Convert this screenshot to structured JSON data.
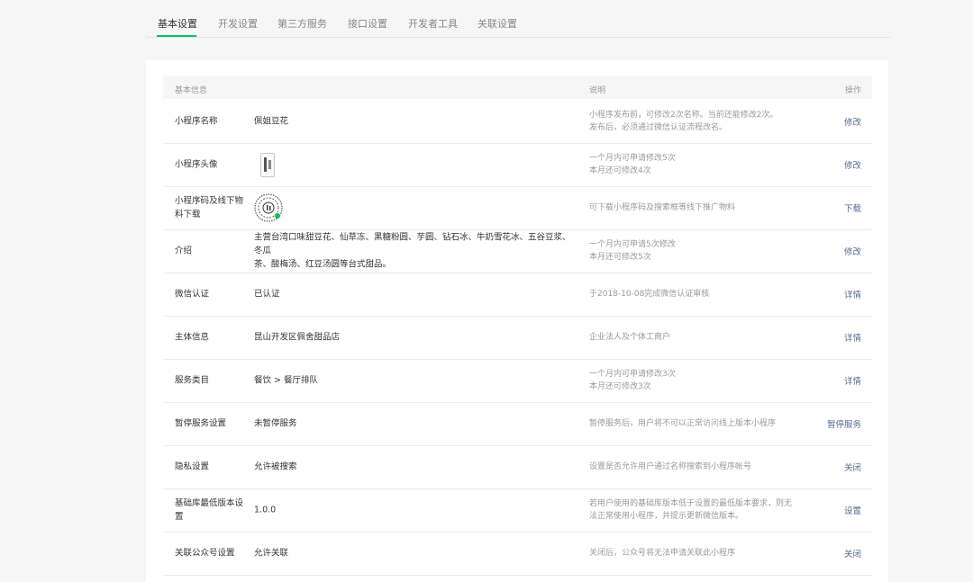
{
  "tabs": [
    "基本设置",
    "开发设置",
    "第三方服务",
    "接口设置",
    "开发者工具",
    "关联设置"
  ],
  "table": {
    "headers": {
      "col1": "基本信息",
      "col3": "说明",
      "col4": "操作"
    },
    "rows": [
      {
        "label": "小程序名称",
        "value": "佩姐豆花",
        "desc1": "小程序发布前，可修改2次名称。当前还能修改2次。",
        "desc2": "发布后，必须通过微信认证流程改名。",
        "action": "修改"
      },
      {
        "label": "小程序头像",
        "value": "",
        "desc1": "一个月内可申请修改5次",
        "desc2": "本月还可修改4次",
        "action": "修改"
      },
      {
        "label1": "小程序码及线下物",
        "label2": "料下载",
        "value": "",
        "desc1": "可下载小程序码及搜索框等线下推广物料",
        "desc2": "",
        "action": "下载"
      },
      {
        "label": "介绍",
        "value1": "主营台湾口味甜豆花、仙草冻、黑糖粉圆、芋圆、钻石冰、牛奶雪花冰、五谷豆浆、冬瓜",
        "value2": "茶、酸梅汤、红豆汤圆等台式甜品。",
        "desc1": "一个月内可申请5次修改",
        "desc2": "本月还可修改5次",
        "action": "修改"
      },
      {
        "label": "微信认证",
        "value": "已认证",
        "desc1": "于2018-10-08完成微信认证审核",
        "desc2": "",
        "action": "详情"
      },
      {
        "label": "主体信息",
        "value": "昆山开发区佩舍甜品店",
        "desc1": "企业法人及个体工商户",
        "desc2": "",
        "action": "详情"
      },
      {
        "label": "服务类目",
        "value": "餐饮 > 餐厅排队",
        "desc1": "一个月内可申请修改3次",
        "desc2": "本月还可修改3次",
        "action": "详情"
      },
      {
        "label": "暂停服务设置",
        "value": "未暂停服务",
        "desc1": "暂停服务后，用户将不可以正常访问线上版本小程序",
        "desc2": "",
        "action": "暂停服务"
      },
      {
        "label": "隐私设置",
        "value": "允许被搜索",
        "desc1": "设置是否允许用户通过名称搜索到小程序帐号",
        "desc2": "",
        "action": "关闭"
      },
      {
        "label1": "基础库最低版本设",
        "label2": "置",
        "value": "1.0.0",
        "desc1": "若用户使用的基础库版本低于设置的最低版本要求，则无",
        "desc2": "法正常使用小程序，并提示更新微信版本。",
        "action": "设置"
      },
      {
        "label": "关联公众号设置",
        "value": "允许关联",
        "desc1": "关闭后，公众号将无法申请关联此小程序",
        "desc2": "",
        "action": "关闭"
      }
    ]
  }
}
